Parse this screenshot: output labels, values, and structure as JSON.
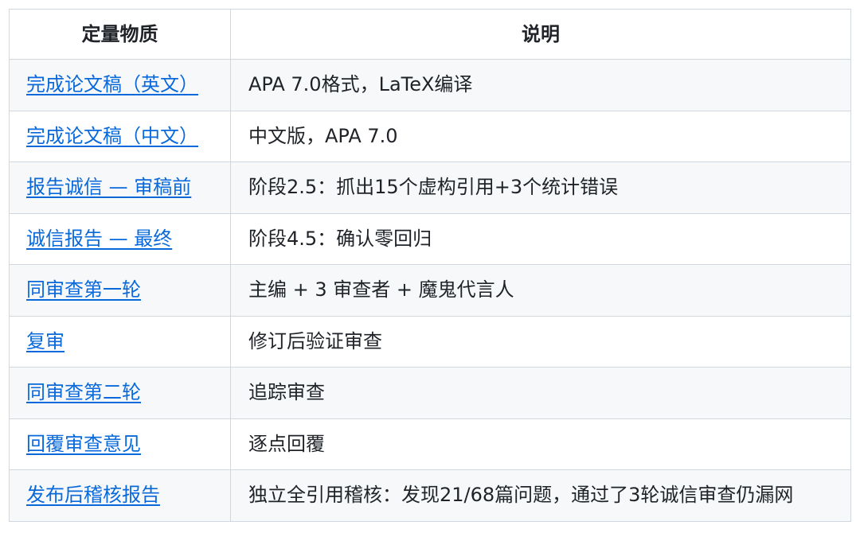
{
  "table": {
    "headers": [
      "定量物质",
      "说明"
    ],
    "rows": [
      {
        "item": "完成论文稿（英文）",
        "desc": "APA 7.0格式，LaTeX编译"
      },
      {
        "item": "完成论文稿（中文）",
        "desc": "中文版，APA 7.0"
      },
      {
        "item": "报告诚信 — 审稿前",
        "desc": "阶段2.5：抓出15个虚构引用+3个统计错误"
      },
      {
        "item": "诚信报告 — 最终",
        "desc": "阶段4.5：确认零回归"
      },
      {
        "item": "同审查第一轮",
        "desc": "主编 + 3 审查者 + 魔鬼代言人"
      },
      {
        "item": "复审",
        "desc": "修订后验证审查"
      },
      {
        "item": "同审查第二轮",
        "desc": "追踪审查"
      },
      {
        "item": "回覆审查意见",
        "desc": "逐点回覆"
      },
      {
        "item": "发布后稽核报告",
        "desc": "独立全引用稽核：发现21/68篇问题，通过了3轮诚信审查仍漏网"
      }
    ]
  },
  "colors": {
    "link": "#0969da",
    "border": "#d0d7de",
    "stripe": "#f6f8fa",
    "text": "#1f2328"
  }
}
